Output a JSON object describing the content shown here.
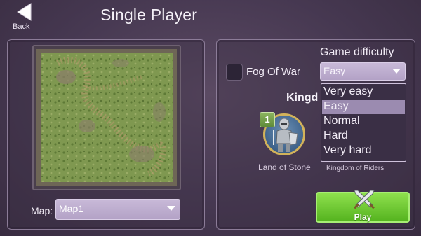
{
  "header": {
    "back_label": "Back",
    "title": "Single Player"
  },
  "map": {
    "label": "Map:",
    "selected": "Map1"
  },
  "options": {
    "fog_of_war_label": "Fog Of War",
    "fog_of_war_checked": false,
    "difficulty_label": "Game difficulty",
    "difficulty_selected": "Easy",
    "difficulty_options": [
      "Very easy",
      "Easy",
      "Normal",
      "Hard",
      "Very hard"
    ],
    "difficulty_highlighted_index": 1
  },
  "kingdoms": {
    "heading_visible": "Kingd",
    "player": {
      "badge": "1",
      "name": "Land of Stone"
    },
    "opponent": {
      "name": "Kingdom of Riders"
    }
  },
  "play_label": "Play",
  "colors": {
    "play_green": "#6cc830",
    "panel_border": "#8c7c98",
    "select_bg": "#bfaed2",
    "avatar_ring": "#d2b25a"
  }
}
